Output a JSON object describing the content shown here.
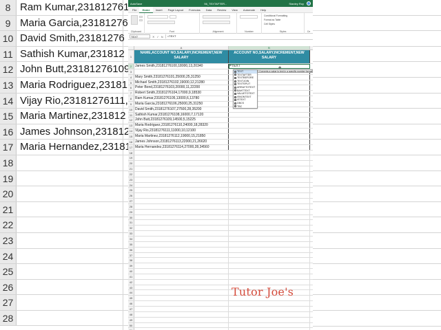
{
  "background_left": {
    "rows": [
      {
        "num": "8",
        "text": "Ram Kumar,2318127610"
      },
      {
        "num": "9",
        "text": "Maria Garcia,231812761"
      },
      {
        "num": "10",
        "text": "David Smith,23181276"
      },
      {
        "num": "11",
        "text": "Sathish Kumar,231812"
      },
      {
        "num": "12",
        "text": "John Butt,23181276109"
      },
      {
        "num": "13",
        "text": "Maria Rodriguez,23181"
      },
      {
        "num": "14",
        "text": "Vijay Rio,23181276111,"
      },
      {
        "num": "15",
        "text": "Maria Martinez,231812"
      },
      {
        "num": "16",
        "text": "James Johnson,231812"
      },
      {
        "num": "17",
        "text": "Maria Hernandez,23181"
      },
      {
        "num": "18",
        "text": ""
      },
      {
        "num": "19",
        "text": ""
      },
      {
        "num": "20",
        "text": ""
      },
      {
        "num": "21",
        "text": ""
      },
      {
        "num": "22",
        "text": ""
      },
      {
        "num": "23",
        "text": ""
      },
      {
        "num": "24",
        "text": ""
      },
      {
        "num": "25",
        "text": ""
      },
      {
        "num": "26",
        "text": ""
      },
      {
        "num": "27",
        "text": ""
      },
      {
        "num": "28",
        "text": ""
      }
    ]
  },
  "window": {
    "autosave_label": "AutoSave",
    "title": "56_TEXTAFTER...",
    "user": "Stanley Roy",
    "tabs": [
      "File",
      "Home",
      "Insert",
      "Page Layout",
      "Formulas",
      "Data",
      "Review",
      "View",
      "Automate",
      "Help"
    ],
    "active_tab": "Home",
    "ribbon_groups": [
      "Clipboard",
      "Font",
      "Alignment",
      "Number",
      "Styles",
      "Ce"
    ],
    "styles_items": [
      "Conditional Formatting",
      "Format as Table",
      "Cell Styles"
    ],
    "name_box": "TEXT",
    "fx_label": "fx",
    "formula": "=TEXT"
  },
  "grid": {
    "columns": [
      "A",
      "B"
    ],
    "header_a": "NAME,ACCOUNT NO,SALARY,INCREMENT,NEW SALARY",
    "header_b": "ACCOUNT NO,SALARY,INCREMENT,NEW SALARY",
    "rows": [
      {
        "num": "2",
        "a": "James Smith,23181276100,18000,13,20340",
        "b": "=TEXT"
      },
      {
        "num": "3",
        "a": "",
        "b": ""
      },
      {
        "num": "4",
        "a": "Mary Smith,23181276101,25000,25,31250",
        "b": ""
      },
      {
        "num": "5",
        "a": "Michael Smith,23181276102,19000,12,21280",
        "b": ""
      },
      {
        "num": "6",
        "a": "Peter Bond,23181276103,20000,11,22200",
        "b": ""
      },
      {
        "num": "7",
        "a": "Robert Smith,23181276104,17000,9,18530",
        "b": ""
      },
      {
        "num": "8",
        "a": "Ram Kumar,23181276105,13000,6,13780",
        "b": ""
      },
      {
        "num": "9",
        "a": "Maria Garcia,23181276106,25000,25,31250",
        "b": ""
      },
      {
        "num": "10",
        "a": "David Smith,23181276107,27500,28,35200",
        "b": ""
      },
      {
        "num": "11",
        "a": "Sathish Kumar,23181276108,16000,7,17120",
        "b": ""
      },
      {
        "num": "12",
        "a": "John Butt,23181276109,14500,5,15225",
        "b": ""
      },
      {
        "num": "13",
        "a": "Maria Rodriguez,23181276110,24000,18,28320",
        "b": ""
      },
      {
        "num": "14",
        "a": "Vijay Rio,23181276111,11000,10,12100",
        "b": ""
      },
      {
        "num": "15",
        "a": "Maria Martinez,23181276112,19000,15,21850",
        "b": ""
      },
      {
        "num": "16",
        "a": "James Johnson,23181276113,22000,21,26620",
        "b": ""
      },
      {
        "num": "17",
        "a": "Maria Hernandez,23181276114,27000,28,34560",
        "b": ""
      },
      {
        "num": "18",
        "a": "",
        "b": ""
      },
      {
        "num": "19",
        "a": "",
        "b": ""
      },
      {
        "num": "20",
        "a": "",
        "b": ""
      },
      {
        "num": "21",
        "a": "",
        "b": ""
      },
      {
        "num": "22",
        "a": "",
        "b": ""
      },
      {
        "num": "23",
        "a": "",
        "b": ""
      },
      {
        "num": "24",
        "a": "",
        "b": ""
      },
      {
        "num": "25",
        "a": "",
        "b": ""
      },
      {
        "num": "26",
        "a": "",
        "b": ""
      },
      {
        "num": "27",
        "a": "",
        "b": ""
      },
      {
        "num": "28",
        "a": "",
        "b": ""
      },
      {
        "num": "29",
        "a": "",
        "b": ""
      },
      {
        "num": "30",
        "a": "",
        "b": ""
      },
      {
        "num": "31",
        "a": "",
        "b": ""
      },
      {
        "num": "32",
        "a": "",
        "b": ""
      },
      {
        "num": "33",
        "a": "",
        "b": ""
      },
      {
        "num": "34",
        "a": "",
        "b": ""
      },
      {
        "num": "35",
        "a": "",
        "b": ""
      },
      {
        "num": "36",
        "a": "",
        "b": ""
      },
      {
        "num": "37",
        "a": "",
        "b": ""
      },
      {
        "num": "38",
        "a": "",
        "b": ""
      },
      {
        "num": "39",
        "a": "",
        "b": ""
      },
      {
        "num": "40",
        "a": "",
        "b": ""
      },
      {
        "num": "41",
        "a": "",
        "b": ""
      },
      {
        "num": "42",
        "a": "",
        "b": ""
      },
      {
        "num": "43",
        "a": "",
        "b": ""
      },
      {
        "num": "44",
        "a": "",
        "b": ""
      },
      {
        "num": "45",
        "a": "",
        "b": ""
      },
      {
        "num": "46",
        "a": "",
        "b": ""
      },
      {
        "num": "47",
        "a": "",
        "b": ""
      },
      {
        "num": "48",
        "a": "",
        "b": ""
      },
      {
        "num": "49",
        "a": "",
        "b": ""
      },
      {
        "num": "50",
        "a": "",
        "b": ""
      },
      {
        "num": "51",
        "a": "",
        "b": ""
      },
      {
        "num": "52",
        "a": "",
        "b": ""
      },
      {
        "num": "53",
        "a": "",
        "b": ""
      }
    ]
  },
  "autocomplete": {
    "items": [
      "TEXT",
      "TEXTAFTER",
      "TEXTBEFORE",
      "TEXTJOIN",
      "TEXTSPLIT",
      "ARRAYTOTEXT",
      "BAHTTEXT",
      "VALUETOTEXT",
      "ISNONTEXT",
      "ISTEXT",
      "DBCS",
      "TBC"
    ],
    "selected": "TEXT",
    "tooltip": "Converts a value to text in a specific number format"
  },
  "watermark": "Tutor Joe's",
  "colors": {
    "excel_green": "#217346",
    "header_fill": "#2f8ca3",
    "watermark": "#d44a3a"
  }
}
